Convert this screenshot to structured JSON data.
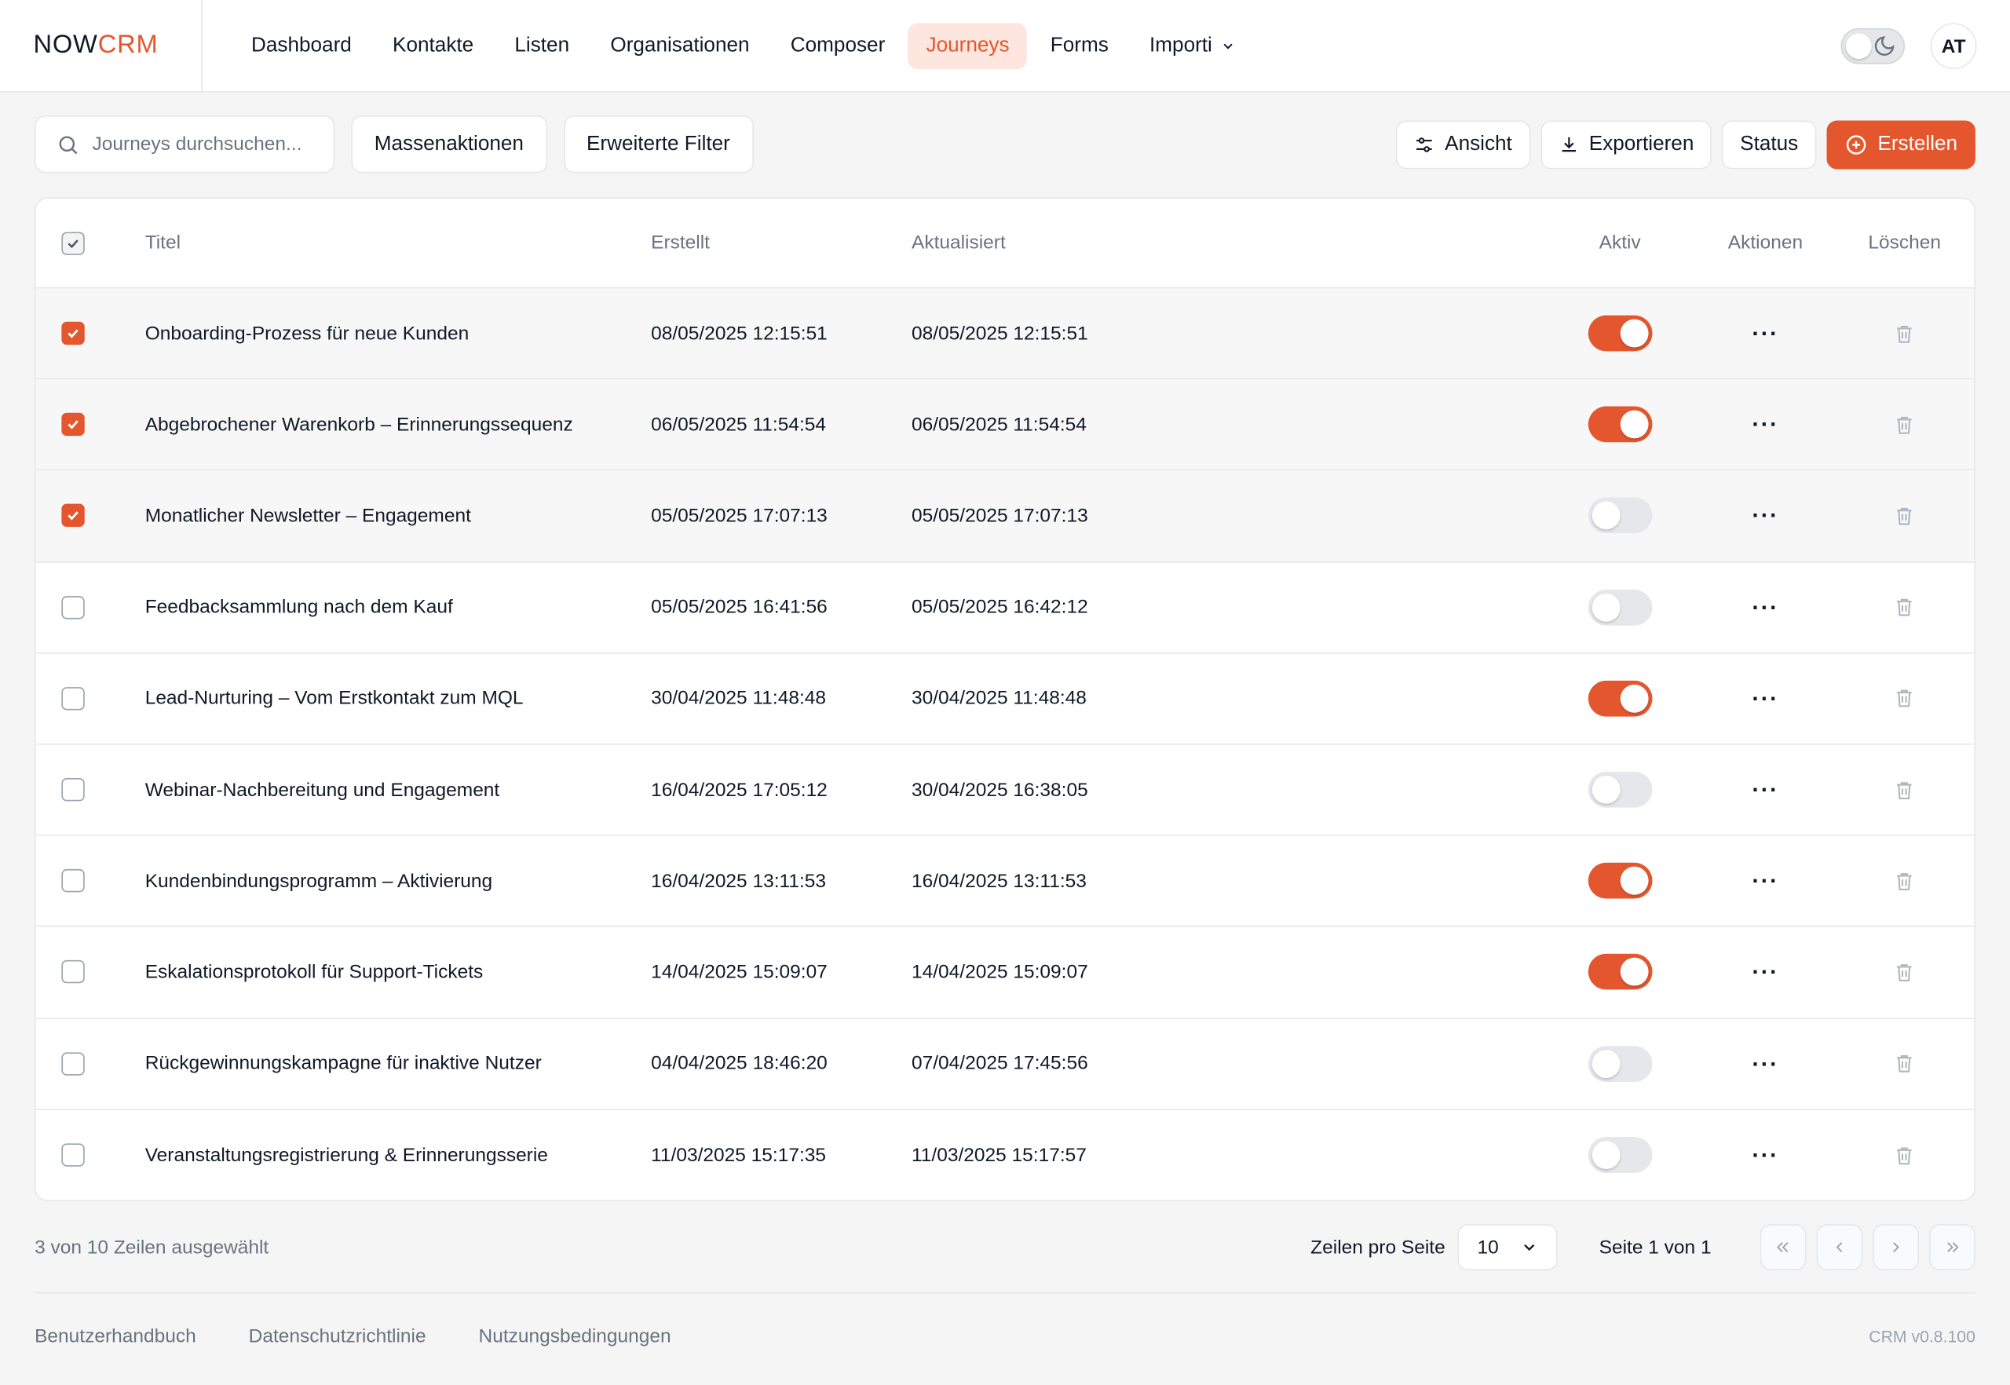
{
  "brand": {
    "now": "NOW",
    "crm": "CRM",
    "accent": "#e4572e"
  },
  "nav": {
    "items": [
      {
        "label": "Dashboard"
      },
      {
        "label": "Kontakte"
      },
      {
        "label": "Listen"
      },
      {
        "label": "Organisationen"
      },
      {
        "label": "Composer"
      },
      {
        "label": "Journeys"
      },
      {
        "label": "Forms"
      },
      {
        "label": "Importi"
      }
    ],
    "active": "Journeys",
    "avatar": "AT",
    "theme_icon": "moon-icon"
  },
  "toolbar": {
    "search_placeholder": "Journeys durchsuchen...",
    "bulk_label": "Massenaktionen",
    "filter_label": "Erweiterte Filter",
    "view_label": "Ansicht",
    "export_label": "Exportieren",
    "status_label": "Status",
    "create_label": "Erstellen"
  },
  "table": {
    "headers": {
      "title": "Titel",
      "created": "Erstellt",
      "updated": "Aktualisiert",
      "active": "Aktiv",
      "actions": "Aktionen",
      "delete": "Löschen"
    },
    "rows": [
      {
        "title": "Onboarding-Prozess für neue Kunden",
        "created": "08/05/2025 12:15:51",
        "updated": "08/05/2025 12:15:51",
        "active": true,
        "selected": true
      },
      {
        "title": "Abgebrochener Warenkorb – Erinnerungssequenz",
        "created": "06/05/2025 11:54:54",
        "updated": "06/05/2025 11:54:54",
        "active": true,
        "selected": true
      },
      {
        "title": "Monatlicher Newsletter – Engagement",
        "created": "05/05/2025 17:07:13",
        "updated": "05/05/2025 17:07:13",
        "active": false,
        "selected": true
      },
      {
        "title": "Feedbacksammlung nach dem Kauf",
        "created": "05/05/2025 16:41:56",
        "updated": "05/05/2025 16:42:12",
        "active": false,
        "selected": false
      },
      {
        "title": "Lead-Nurturing – Vom Erstkontakt zum MQL",
        "created": "30/04/2025 11:48:48",
        "updated": "30/04/2025 11:48:48",
        "active": true,
        "selected": false
      },
      {
        "title": "Webinar-Nachbereitung und Engagement",
        "created": "16/04/2025 17:05:12",
        "updated": "30/04/2025 16:38:05",
        "active": false,
        "selected": false
      },
      {
        "title": "Kundenbindungsprogramm – Aktivierung",
        "created": "16/04/2025 13:11:53",
        "updated": "16/04/2025 13:11:53",
        "active": true,
        "selected": false
      },
      {
        "title": "Eskalationsprotokoll für Support-Tickets",
        "created": "14/04/2025 15:09:07",
        "updated": "14/04/2025 15:09:07",
        "active": true,
        "selected": false
      },
      {
        "title": "Rückgewinnungskampagne für inaktive Nutzer",
        "created": "04/04/2025 18:46:20",
        "updated": "07/04/2025 17:45:56",
        "active": false,
        "selected": false
      },
      {
        "title": "Veranstaltungsregistrierung & Erinnerungsserie",
        "created": "11/03/2025 15:17:35",
        "updated": "11/03/2025 15:17:57",
        "active": false,
        "selected": false
      }
    ]
  },
  "pager": {
    "selection_info": "3 von 10  Zeilen ausgewählt",
    "rows_label": "Zeilen pro Seite",
    "rows_value": "10",
    "page_info": "Seite 1  von  1"
  },
  "footer": {
    "links": [
      "Benutzerhandbuch",
      "Datenschutzrichtlinie",
      "Nutzungsbedingungen"
    ],
    "version": "CRM v0.8.100"
  }
}
